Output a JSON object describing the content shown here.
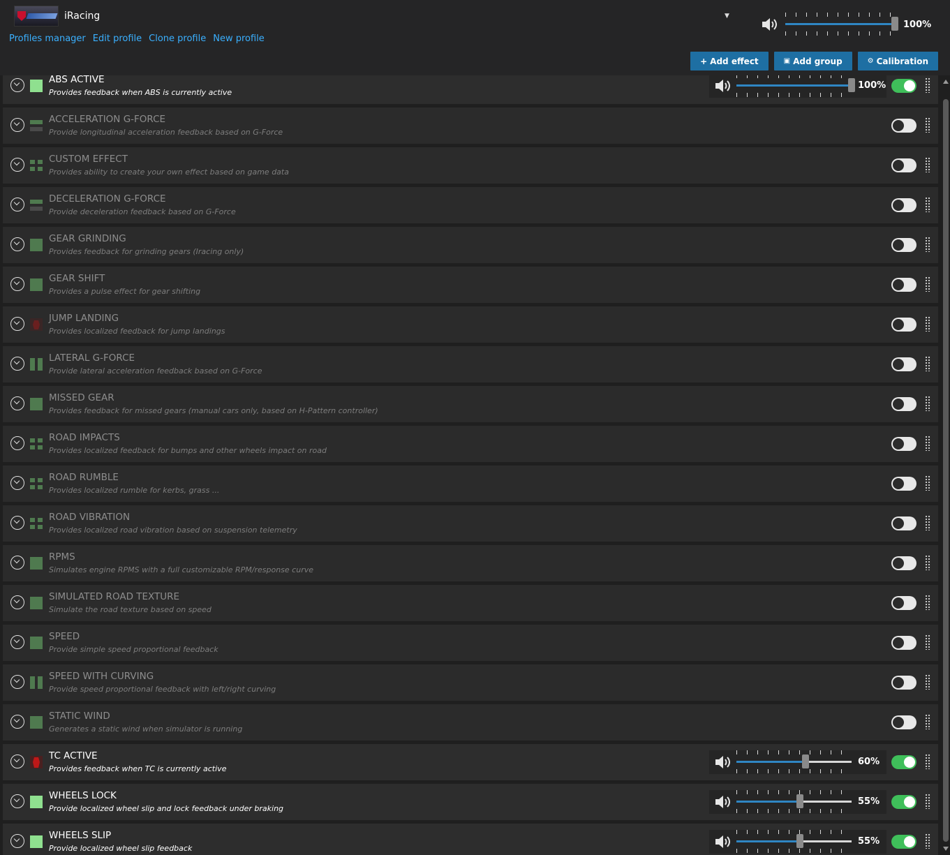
{
  "header": {
    "app_title": "iRacing",
    "links": [
      "Profiles manager",
      "Edit profile",
      "Clone profile",
      "New profile"
    ],
    "master_volume": {
      "percent_label": "100%",
      "level": 1.0
    },
    "buttons": {
      "add_effect": "Add effect",
      "add_group": "Add group",
      "calibration": "Calibration"
    }
  },
  "colors": {
    "accent": "#2f86c3",
    "link": "#3ab0ff",
    "toggle_on": "#3fbf5a",
    "button": "#1e6fa3"
  },
  "effects": [
    {
      "title": "ABS ACTIVE",
      "desc": "Provides feedback when ABS is currently active",
      "icon": "square-bright",
      "enabled": true,
      "volume_label": "100%",
      "level": 1.0
    },
    {
      "title": "ACCELERATION G-FORCE",
      "desc": "Provide longitudinal acceleration feedback based on G-Force",
      "icon": "hbars",
      "enabled": false
    },
    {
      "title": "CUSTOM EFFECT",
      "desc": "Provides ability to create your own effect based on game data",
      "icon": "grid",
      "enabled": false
    },
    {
      "title": "DECELERATION G-FORCE",
      "desc": "Provide deceleration feedback based on G-Force",
      "icon": "hbars",
      "enabled": false
    },
    {
      "title": "GEAR GRINDING",
      "desc": "Provides feedback for grinding gears (Iracing only)",
      "icon": "square",
      "enabled": false
    },
    {
      "title": "GEAR SHIFT",
      "desc": "Provides a pulse effect for gear shifting",
      "icon": "square",
      "enabled": false
    },
    {
      "title": "JUMP LANDING",
      "desc": "Provides localized feedback for jump landings",
      "icon": "car",
      "enabled": false
    },
    {
      "title": "LATERAL G-FORCE",
      "desc": "Provide lateral acceleration feedback based on G-Force",
      "icon": "vbars",
      "enabled": false
    },
    {
      "title": "MISSED GEAR",
      "desc": "Provides feedback for missed gears (manual cars only, based on H-Pattern controller)",
      "icon": "square",
      "enabled": false
    },
    {
      "title": "ROAD IMPACTS",
      "desc": "Provides localized feedback for bumps and other wheels impact on road",
      "icon": "grid",
      "enabled": false
    },
    {
      "title": "ROAD RUMBLE",
      "desc": "Provides localized rumble for kerbs, grass ...",
      "icon": "grid",
      "enabled": false
    },
    {
      "title": "ROAD VIBRATION",
      "desc": "Provides localized road vibration based on suspension telemetry",
      "icon": "grid",
      "enabled": false
    },
    {
      "title": "RPMS",
      "desc": "Simulates engine RPMS with a full customizable RPM/response curve",
      "icon": "square",
      "enabled": false
    },
    {
      "title": "SIMULATED ROAD TEXTURE",
      "desc": "Simulate the road texture based on speed",
      "icon": "square",
      "enabled": false
    },
    {
      "title": "SPEED",
      "desc": "Provide simple speed proportional feedback",
      "icon": "square",
      "enabled": false
    },
    {
      "title": "SPEED WITH CURVING",
      "desc": "Provide speed proportional feedback with left/right curving",
      "icon": "vbars",
      "enabled": false
    },
    {
      "title": "STATIC WIND",
      "desc": "Generates a static wind when simulator is running",
      "icon": "square",
      "enabled": false
    },
    {
      "title": "TC ACTIVE",
      "desc": "Provides feedback when TC is currently active",
      "icon": "car-bright",
      "enabled": true,
      "volume_label": "60%",
      "level": 0.6
    },
    {
      "title": "WHEELS LOCK",
      "desc": "Provide localized wheel slip and lock feedback under braking",
      "icon": "square-bright",
      "enabled": true,
      "volume_label": "55%",
      "level": 0.55
    },
    {
      "title": "WHEELS SLIP",
      "desc": "Provide localized wheel slip feedback",
      "icon": "square-bright",
      "enabled": true,
      "volume_label": "55%",
      "level": 0.55
    }
  ]
}
